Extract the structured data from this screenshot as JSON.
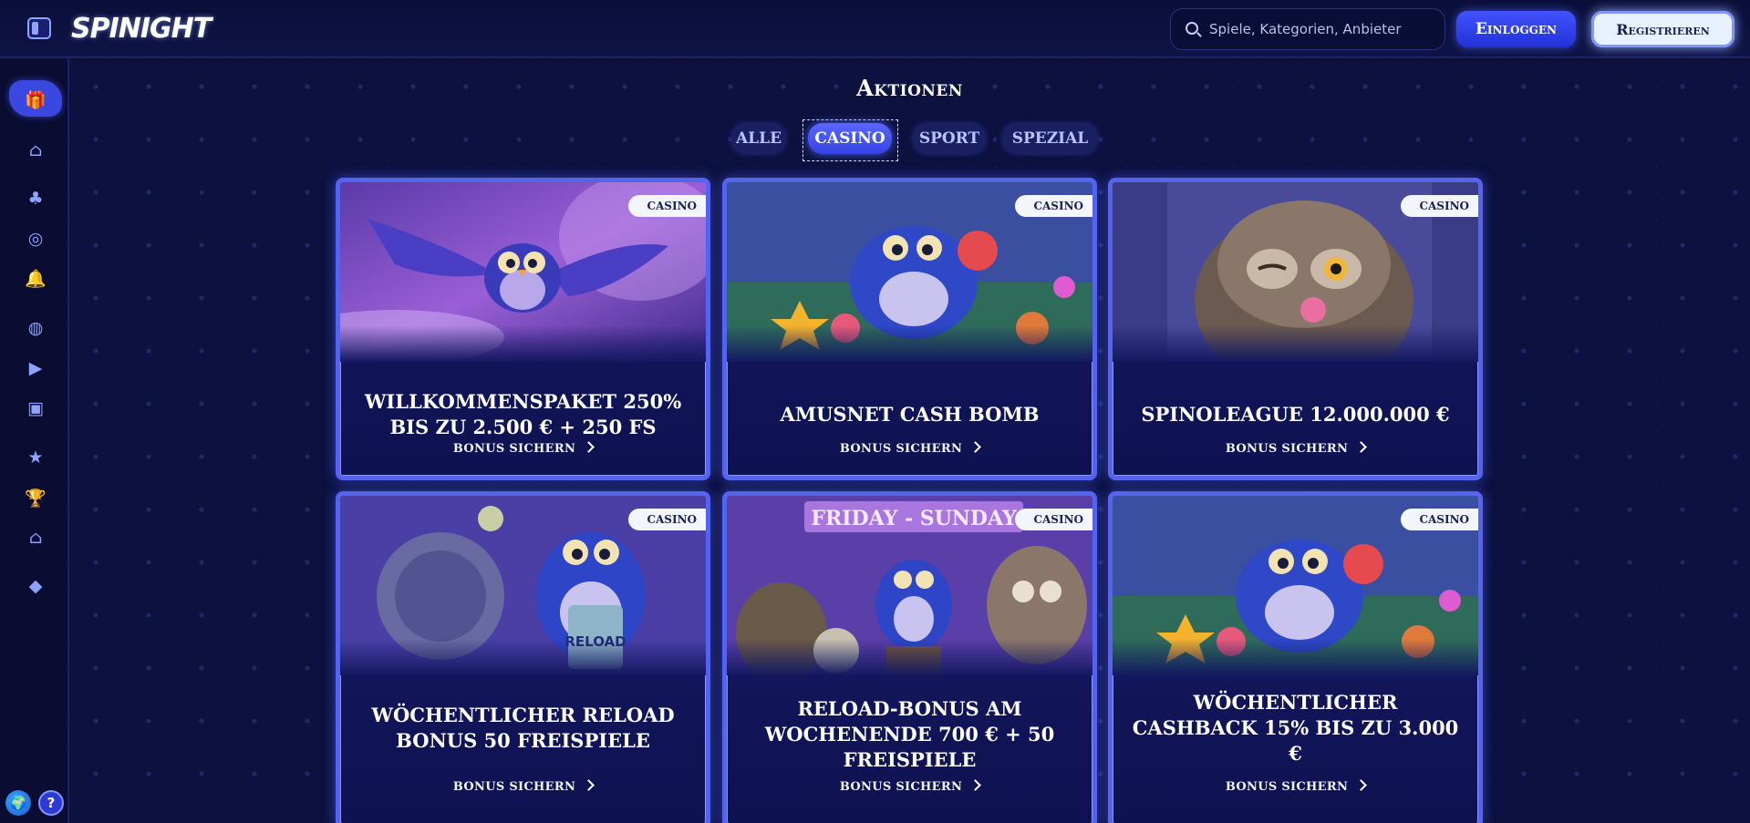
{
  "header": {
    "logo": "SPINIGHT",
    "search_placeholder": "Spiele, Kategorien, Anbieter",
    "login_label": "Einloggen",
    "register_label": "Registrieren"
  },
  "sidebar": {
    "items": [
      {
        "name": "promotions",
        "icon": "gift-icon",
        "glyph": "🎁"
      },
      {
        "name": "home",
        "icon": "home-icon",
        "glyph": "⌂"
      },
      {
        "name": "casino",
        "icon": "club-icon",
        "glyph": "♣"
      },
      {
        "name": "live-casino",
        "icon": "roulette-icon",
        "glyph": "◎"
      },
      {
        "name": "slots",
        "icon": "bell-icon",
        "glyph": "🔔"
      },
      {
        "name": "sport",
        "icon": "basketball-icon",
        "glyph": "◍"
      },
      {
        "name": "live-sport",
        "icon": "play-icon",
        "glyph": "▶"
      },
      {
        "name": "virtual",
        "icon": "monitor-icon",
        "glyph": "▣"
      },
      {
        "name": "vip",
        "icon": "star-shield-icon",
        "glyph": "★"
      },
      {
        "name": "tournaments",
        "icon": "trophy-icon",
        "glyph": "🏆"
      },
      {
        "name": "shop",
        "icon": "store-icon",
        "glyph": "⌂"
      },
      {
        "name": "loyalty",
        "icon": "diamond-icon",
        "glyph": "◆"
      }
    ],
    "help_glyph": "?",
    "globe_glyph": "🌍"
  },
  "main": {
    "title": "Aktionen",
    "tabs": [
      {
        "label": "ALLE",
        "active": false
      },
      {
        "label": "CASINO",
        "active": true
      },
      {
        "label": "SPORT",
        "active": false
      },
      {
        "label": "SPEZIAL",
        "active": false
      }
    ],
    "cards": [
      {
        "badge": "CASINO",
        "title": "WILLKOMMENSPAKET 250% BIS ZU 2.500 € + 250 FS",
        "cta": "BONUS SICHERN"
      },
      {
        "badge": "CASINO",
        "title": "AMUSNET CASH BOMB",
        "cta": "BONUS SICHERN"
      },
      {
        "badge": "CASINO",
        "title": "SPINOLEAGUE 12.000.000 €",
        "cta": "BONUS SICHERN"
      },
      {
        "badge": "CASINO",
        "title": "WÖCHENTLICHER RELOAD BONUS 50 FREISPIELE",
        "cta": "BONUS SICHERN",
        "image_text": "RELOAD"
      },
      {
        "badge": "CASINO",
        "title": "RELOAD-BONUS AM WOCHENENDE 700 € + 50 FREISPIELE",
        "cta": "BONUS SICHERN",
        "image_text": "FRIDAY - SUNDAY"
      },
      {
        "badge": "CASINO",
        "title": "WÖCHENTLICHER CASHBACK 15% BIS ZU 3.000 €",
        "cta": "BONUS SICHERN"
      }
    ]
  },
  "colors": {
    "background": "#0b0d33",
    "accent": "#3444e4",
    "card_border": "#5464f0",
    "icon": "#8ea2ff"
  }
}
